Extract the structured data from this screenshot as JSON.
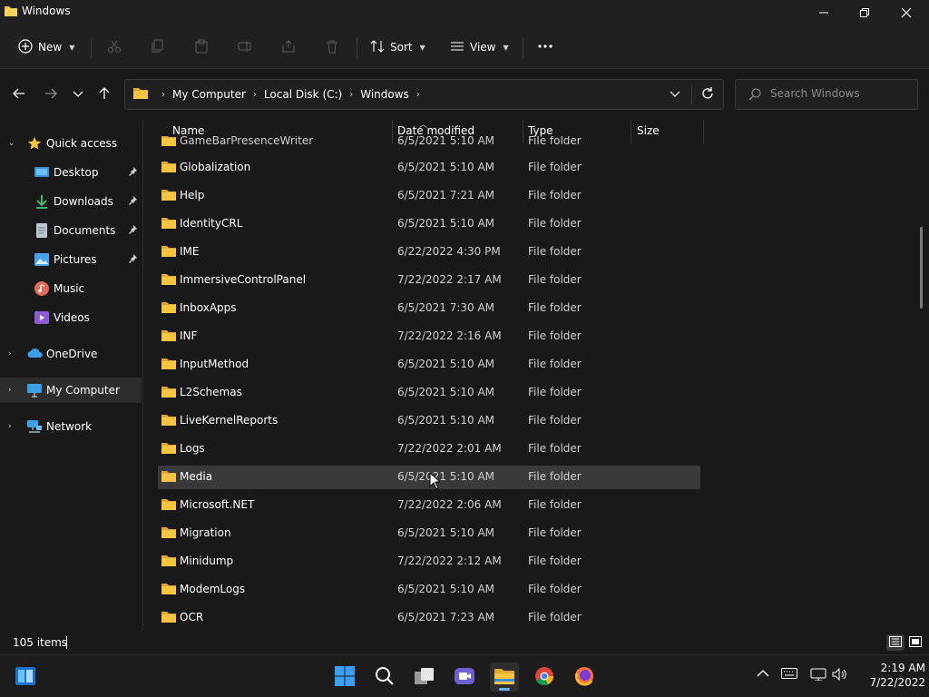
{
  "window": {
    "title": "Windows"
  },
  "toolbar": {
    "new_label": "New",
    "sort_label": "Sort",
    "view_label": "View"
  },
  "address": {
    "crumbs": [
      "My Computer",
      "Local Disk (C:)",
      "Windows"
    ]
  },
  "search": {
    "placeholder": "Search Windows"
  },
  "sidebar": {
    "quick_access": "Quick access",
    "items": [
      {
        "label": "Desktop",
        "pinned": true
      },
      {
        "label": "Downloads",
        "pinned": true
      },
      {
        "label": "Documents",
        "pinned": true
      },
      {
        "label": "Pictures",
        "pinned": true
      },
      {
        "label": "Music",
        "pinned": false
      },
      {
        "label": "Videos",
        "pinned": false
      }
    ],
    "onedrive": "OneDrive",
    "my_computer": "My Computer",
    "network": "Network"
  },
  "columns": {
    "name": "Name",
    "date": "Date modified",
    "type": "Type",
    "size": "Size"
  },
  "partial_row": {
    "name": "GameBarPresenceWriter",
    "date": "6/5/2021 5:10 AM",
    "type": "File folder"
  },
  "files": [
    {
      "name": "Globalization",
      "date": "6/5/2021 5:10 AM",
      "type": "File folder"
    },
    {
      "name": "Help",
      "date": "6/5/2021 7:21 AM",
      "type": "File folder"
    },
    {
      "name": "IdentityCRL",
      "date": "6/5/2021 5:10 AM",
      "type": "File folder"
    },
    {
      "name": "IME",
      "date": "6/22/2022 4:30 PM",
      "type": "File folder"
    },
    {
      "name": "ImmersiveControlPanel",
      "date": "7/22/2022 2:17 AM",
      "type": "File folder"
    },
    {
      "name": "InboxApps",
      "date": "6/5/2021 7:30 AM",
      "type": "File folder"
    },
    {
      "name": "INF",
      "date": "7/22/2022 2:16 AM",
      "type": "File folder"
    },
    {
      "name": "InputMethod",
      "date": "6/5/2021 5:10 AM",
      "type": "File folder"
    },
    {
      "name": "L2Schemas",
      "date": "6/5/2021 5:10 AM",
      "type": "File folder"
    },
    {
      "name": "LiveKernelReports",
      "date": "6/5/2021 5:10 AM",
      "type": "File folder"
    },
    {
      "name": "Logs",
      "date": "7/22/2022 2:01 AM",
      "type": "File folder"
    },
    {
      "name": "Media",
      "date": "6/5/2021 5:10 AM",
      "type": "File folder"
    },
    {
      "name": "Microsoft.NET",
      "date": "7/22/2022 2:06 AM",
      "type": "File folder"
    },
    {
      "name": "Migration",
      "date": "6/5/2021 5:10 AM",
      "type": "File folder"
    },
    {
      "name": "Minidump",
      "date": "7/22/2022 2:12 AM",
      "type": "File folder"
    },
    {
      "name": "ModemLogs",
      "date": "6/5/2021 5:10 AM",
      "type": "File folder"
    },
    {
      "name": "OCR",
      "date": "6/5/2021 7:23 AM",
      "type": "File folder"
    }
  ],
  "hovered_file": "Media",
  "status": {
    "count": "105 items"
  },
  "clock": {
    "time": "2:19 AM",
    "date": "7/22/2022"
  },
  "colors": {
    "folder": "#f0c040",
    "accent": "#6ab0ff",
    "selection": "#2d2d2d"
  }
}
